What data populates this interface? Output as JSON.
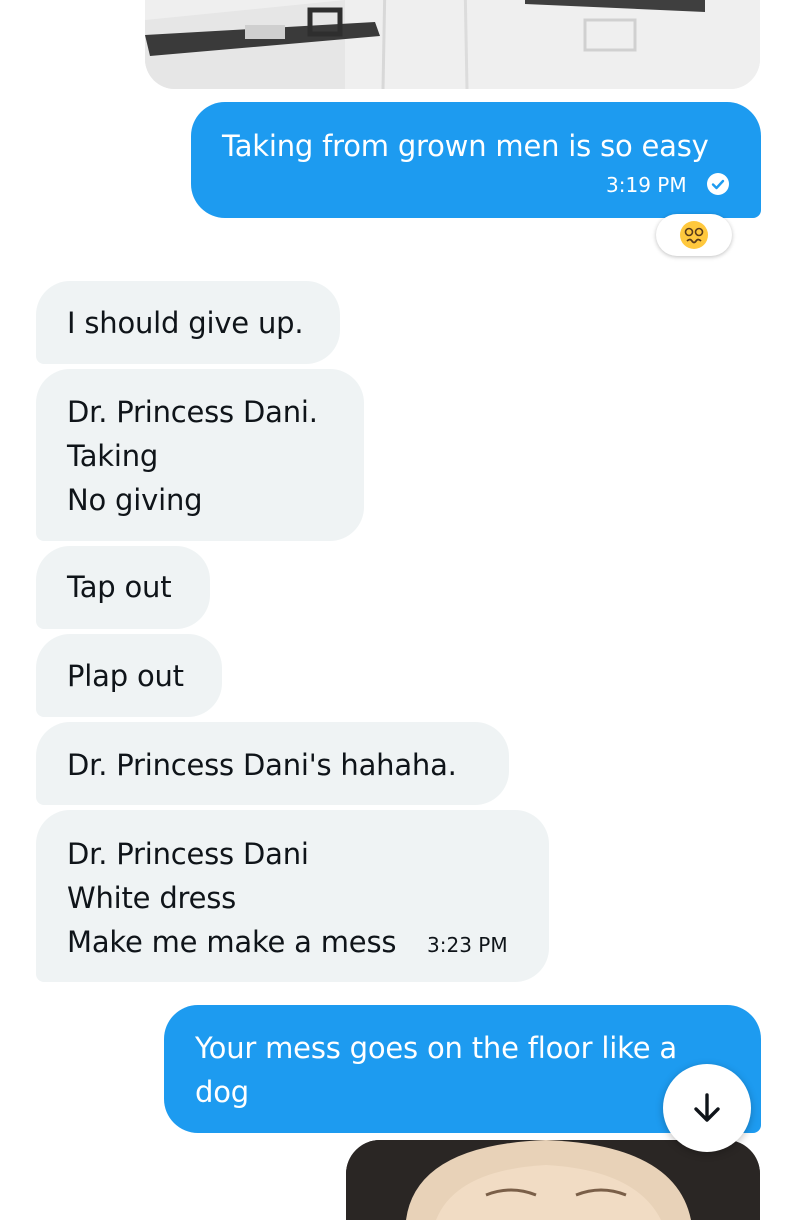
{
  "messages": [
    {
      "text": "Taking from grown men is so easy",
      "time": "3:19 PM"
    },
    {
      "text": "I should give up."
    },
    {
      "text": "Dr. Princess Dani.\nTaking\nNo giving"
    },
    {
      "text": "Tap out"
    },
    {
      "text": "Plap out"
    },
    {
      "text": "Dr. Princess Dani's hahaha."
    },
    {
      "text": "Dr. Princess Dani\nWhite dress\nMake me make a mess",
      "time": "3:23 PM"
    },
    {
      "text": "Your mess goes on the floor like a\ndog"
    }
  ],
  "reaction": {
    "emoji": "woozy-face-icon"
  },
  "colors": {
    "outgoing": "#1d9bf0",
    "incoming": "#eff3f4"
  },
  "icons": {
    "read": "check-circle-icon",
    "scroll": "arrow-down-icon"
  }
}
